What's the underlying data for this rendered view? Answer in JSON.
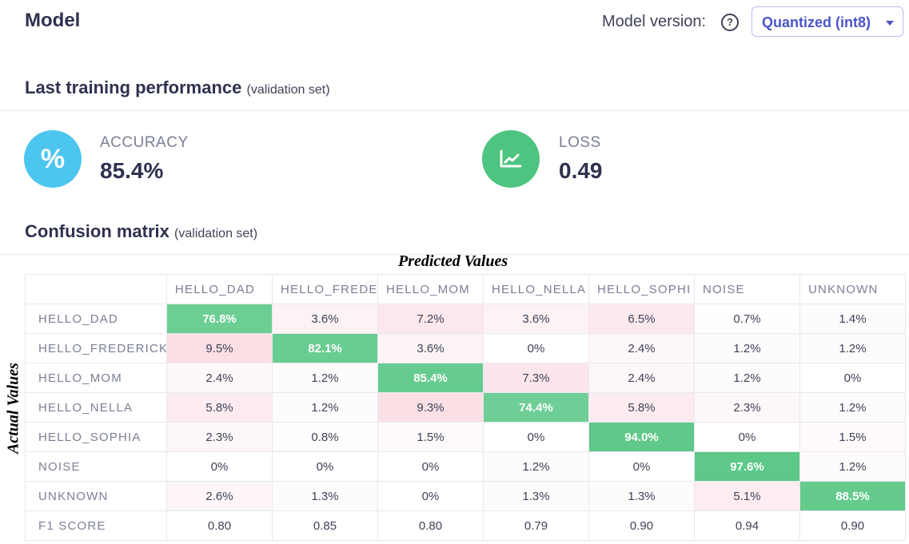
{
  "header": {
    "title": "Model",
    "model_version_label": "Model version:",
    "help_icon": "question-circle-icon",
    "model_version_value": "Quantized (int8)"
  },
  "performance": {
    "title": "Last training performance",
    "subtitle": "(validation set)",
    "accuracy": {
      "label": "ACCURACY",
      "value": "85.4%",
      "icon": "percent-icon",
      "color": "#4cc6ef"
    },
    "loss": {
      "label": "LOSS",
      "value": "0.49",
      "icon": "trend-chart-icon",
      "color": "#4dc47f"
    }
  },
  "confusion": {
    "title": "Confusion matrix",
    "subtitle": "(validation set)",
    "predicted_label": "Predicted Values",
    "actual_label": "Actual Values",
    "columns": [
      "HELLO_DAD",
      "HELLO_FREDE",
      "HELLO_MOM",
      "HELLO_NELLA",
      "HELLO_SOPHI",
      "NOISE",
      "UNKNOWN"
    ],
    "rows": [
      {
        "label": "HELLO_DAD",
        "values": [
          "76.8%",
          "3.6%",
          "7.2%",
          "3.6%",
          "6.5%",
          "0.7%",
          "1.4%"
        ]
      },
      {
        "label": "HELLO_FREDERICK",
        "values": [
          "9.5%",
          "82.1%",
          "3.6%",
          "0%",
          "2.4%",
          "1.2%",
          "1.2%"
        ]
      },
      {
        "label": "HELLO_MOM",
        "values": [
          "2.4%",
          "1.2%",
          "85.4%",
          "7.3%",
          "2.4%",
          "1.2%",
          "0%"
        ]
      },
      {
        "label": "HELLO_NELLA",
        "values": [
          "5.8%",
          "1.2%",
          "9.3%",
          "74.4%",
          "5.8%",
          "2.3%",
          "1.2%"
        ]
      },
      {
        "label": "HELLO_SOPHIA",
        "values": [
          "2.3%",
          "0.8%",
          "1.5%",
          "0%",
          "94.0%",
          "0%",
          "1.5%"
        ]
      },
      {
        "label": "NOISE",
        "values": [
          "0%",
          "0%",
          "0%",
          "1.2%",
          "0%",
          "97.6%",
          "1.2%"
        ]
      },
      {
        "label": "UNKNOWN",
        "values": [
          "2.6%",
          "1.3%",
          "0%",
          "1.3%",
          "1.3%",
          "5.1%",
          "88.5%"
        ]
      }
    ],
    "f1": {
      "label": "F1 SCORE",
      "values": [
        "0.80",
        "0.85",
        "0.80",
        "0.79",
        "0.90",
        "0.94",
        "0.90"
      ]
    },
    "colors": {
      "correct": "#5cc887",
      "error": "#e8456b"
    }
  }
}
